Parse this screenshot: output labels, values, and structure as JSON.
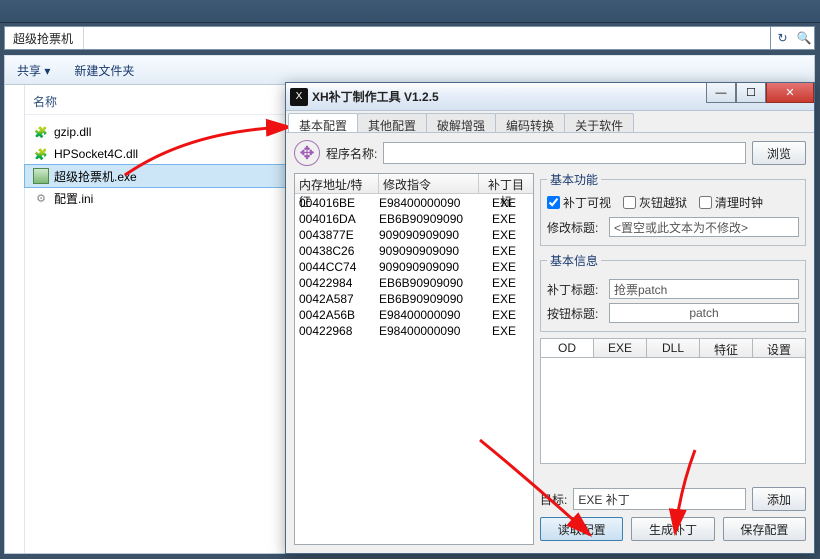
{
  "explorer": {
    "breadcrumb": "超级抢票机",
    "toolbar": {
      "share": "共享 ▾",
      "newfolder": "新建文件夹"
    },
    "col_name": "名称",
    "files": [
      {
        "name": "gzip.dll",
        "type": "dll"
      },
      {
        "name": "HPSocket4C.dll",
        "type": "dll"
      },
      {
        "name": "超级抢票机.exe",
        "type": "exe",
        "selected": true
      },
      {
        "name": "配置.ini",
        "type": "ini"
      }
    ]
  },
  "tool": {
    "title": "XH补丁制作工具 V1.2.5",
    "tabs": [
      "基本配置",
      "其他配置",
      "破解增强",
      "编码转换",
      "关于软件"
    ],
    "active_tab": 0,
    "prog_label": "程序名称:",
    "prog_value": "",
    "browse": "浏览",
    "table_headers": [
      "内存地址/特征",
      "修改指令",
      "补丁目标"
    ],
    "rows": [
      {
        "addr": "004016BE",
        "op": "E98400000090",
        "tgt": "EXE"
      },
      {
        "addr": "004016DA",
        "op": "EB6B90909090",
        "tgt": "EXE"
      },
      {
        "addr": "0043877E",
        "op": "909090909090",
        "tgt": "EXE"
      },
      {
        "addr": "00438C26",
        "op": "909090909090",
        "tgt": "EXE"
      },
      {
        "addr": "0044CC74",
        "op": "909090909090",
        "tgt": "EXE"
      },
      {
        "addr": "00422984",
        "op": "EB6B90909090",
        "tgt": "EXE"
      },
      {
        "addr": "0042A587",
        "op": "EB6B90909090",
        "tgt": "EXE"
      },
      {
        "addr": "0042A56B",
        "op": "E98400000090",
        "tgt": "EXE"
      },
      {
        "addr": "00422968",
        "op": "E98400000090",
        "tgt": "EXE"
      }
    ],
    "basic_func": {
      "legend": "基本功能",
      "chk_visible": "补丁可视",
      "chk_gray": "灰钮越狱",
      "chk_clear": "清理时钟",
      "modify_title_label": "修改标题:",
      "modify_title_value": "<置空或此文本为不修改>"
    },
    "basic_info": {
      "legend": "基本信息",
      "patch_title_label": "补丁标题:",
      "patch_title_value": "抢票patch",
      "button_title_label": "按钮标题:",
      "button_title_value": "patch"
    },
    "mini_tabs": [
      "OD",
      "EXE",
      "DLL",
      "特征",
      "设置"
    ],
    "target_label": "目标:",
    "target_value": "EXE 补丁",
    "add_btn": "添加",
    "read_btn": "读取配置",
    "gen_btn": "生成补丁",
    "save_btn": "保存配置"
  }
}
